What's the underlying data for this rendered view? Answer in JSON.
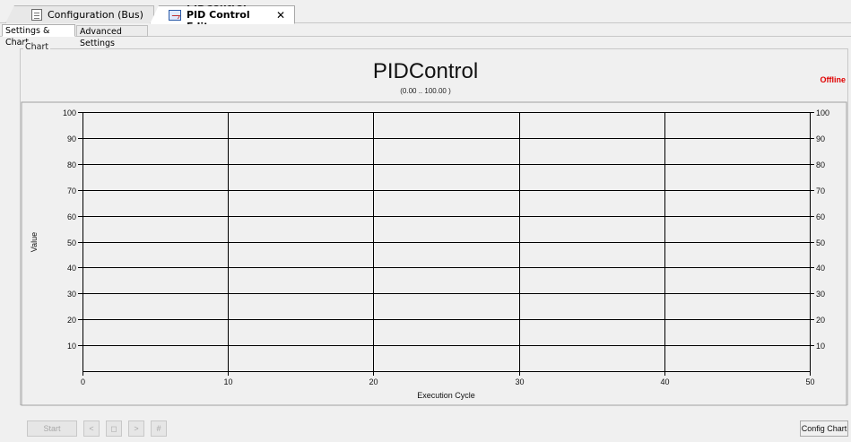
{
  "editor_tabs": [
    {
      "label": "Configuration (Bus)",
      "icon": "document-icon",
      "active": false
    },
    {
      "label": "PIDControl - PID Control Editor",
      "icon": "chart-icon",
      "active": true,
      "close": "✕"
    }
  ],
  "sub_tabs": [
    {
      "label": "Settings & Chart",
      "active": true
    },
    {
      "label": "Advanced Settings",
      "active": false
    }
  ],
  "group_label": "Chart",
  "title": "PIDControl",
  "range": "(0.00 .. 100.00 )",
  "status": "Offline",
  "chart_data": {
    "type": "line",
    "xlabel": "Execution Cycle",
    "ylabel": "Value",
    "xlim": [
      0,
      50
    ],
    "ylim": [
      0,
      100
    ],
    "x_ticks": [
      "0",
      "10",
      "20",
      "30",
      "40",
      "50"
    ],
    "y_ticks": [
      "10",
      "20",
      "30",
      "40",
      "50",
      "60",
      "70",
      "80",
      "90",
      "100"
    ],
    "grid": true,
    "series": []
  },
  "buttons": {
    "start": "Start",
    "prev": "<",
    "stop": "◻",
    "next": ">",
    "reset": "#",
    "config": "Config Chart"
  },
  "colors": {
    "status": "#e00000",
    "grid": "#000000"
  }
}
